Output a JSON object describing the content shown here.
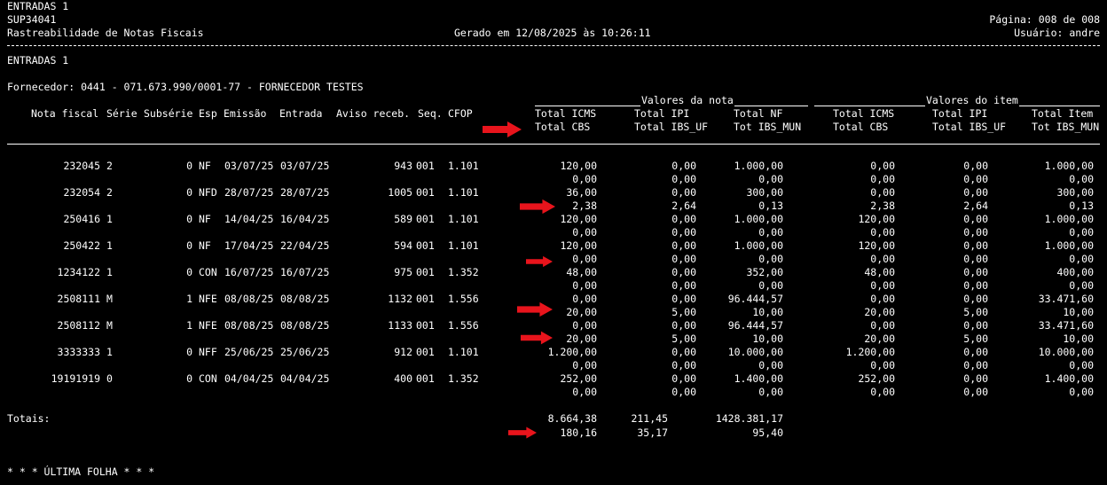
{
  "header": {
    "line1": "ENTRADAS 1",
    "program": "SUP34041",
    "title": "Rastreabilidade de Notas Fiscais",
    "generated": "Gerado em 12/08/2025 às 10:26:11",
    "page": "Página: 008 de 008",
    "user": "Usuário: andre"
  },
  "section_title": "ENTRADAS 1",
  "supplier": "Fornecedor: 0441 - 071.673.990/0001-77 - FORNECEDOR TESTES",
  "group_headers": {
    "nota": "Valores da nota",
    "item": "Valores do item"
  },
  "columns": {
    "nota_fiscal": "Nota fiscal",
    "serie": "Série",
    "subserie": "Subsérie",
    "esp": "Esp",
    "emissao": "Emissão",
    "entrada": "Entrada",
    "aviso": "Aviso receb.",
    "seq": "Seq.",
    "cfop": "CFOP",
    "n_total_icms": "Total ICMS",
    "n_total_cbs": "Total CBS",
    "n_total_ipi": "Total IPI",
    "n_total_ibs_uf": "Total IBS_UF",
    "n_total_nf": "Total NF",
    "n_tot_ibs_mun": "Tot IBS_MUN",
    "i_total_icms": "Total ICMS",
    "i_total_cbs": "Total CBS",
    "i_total_ipi": "Total IPI",
    "i_total_ibs_uf": "Total IBS_UF",
    "i_total_item": "Total Item",
    "i_tot_ibs_mun": "Tot IBS_MUN"
  },
  "rows": [
    {
      "nf": "232045",
      "serie": "2",
      "sub": "0",
      "esp": "NF",
      "emissao": "03/07/25",
      "entrada": "03/07/25",
      "aviso": "943",
      "seq": "001",
      "cfop": "1.101",
      "a": [
        "120,00",
        "0,00",
        "1.000,00",
        "0,00",
        "0,00",
        "1.000,00"
      ],
      "b": [
        "0,00",
        "0,00",
        "0,00",
        "0,00",
        "0,00",
        "0,00"
      ]
    },
    {
      "nf": "232054",
      "serie": "2",
      "sub": "0",
      "esp": "NFD",
      "emissao": "28/07/25",
      "entrada": "28/07/25",
      "aviso": "1005",
      "seq": "001",
      "cfop": "1.101",
      "a": [
        "36,00",
        "0,00",
        "300,00",
        "0,00",
        "0,00",
        "300,00"
      ],
      "b": [
        "2,38",
        "2,64",
        "0,13",
        "2,38",
        "2,64",
        "0,13"
      ]
    },
    {
      "nf": "250416",
      "serie": "1",
      "sub": "0",
      "esp": "NF",
      "emissao": "14/04/25",
      "entrada": "16/04/25",
      "aviso": "589",
      "seq": "001",
      "cfop": "1.101",
      "a": [
        "120,00",
        "0,00",
        "1.000,00",
        "120,00",
        "0,00",
        "1.000,00"
      ],
      "b": [
        "0,00",
        "0,00",
        "0,00",
        "0,00",
        "0,00",
        "0,00"
      ]
    },
    {
      "nf": "250422",
      "serie": "1",
      "sub": "0",
      "esp": "NF",
      "emissao": "17/04/25",
      "entrada": "22/04/25",
      "aviso": "594",
      "seq": "001",
      "cfop": "1.101",
      "a": [
        "120,00",
        "0,00",
        "1.000,00",
        "120,00",
        "0,00",
        "1.000,00"
      ],
      "b": [
        "0,00",
        "0,00",
        "0,00",
        "0,00",
        "0,00",
        "0,00"
      ]
    },
    {
      "nf": "1234122",
      "serie": "1",
      "sub": "0",
      "esp": "CON",
      "emissao": "16/07/25",
      "entrada": "16/07/25",
      "aviso": "975",
      "seq": "001",
      "cfop": "1.352",
      "a": [
        "48,00",
        "0,00",
        "352,00",
        "48,00",
        "0,00",
        "400,00"
      ],
      "b": [
        "0,00",
        "0,00",
        "0,00",
        "0,00",
        "0,00",
        "0,00"
      ]
    },
    {
      "nf": "2508111",
      "serie": "M",
      "sub": "1",
      "esp": "NFE",
      "emissao": "08/08/25",
      "entrada": "08/08/25",
      "aviso": "1132",
      "seq": "001",
      "cfop": "1.556",
      "a": [
        "0,00",
        "0,00",
        "96.444,57",
        "0,00",
        "0,00",
        "33.471,60"
      ],
      "b": [
        "20,00",
        "5,00",
        "10,00",
        "20,00",
        "5,00",
        "10,00"
      ]
    },
    {
      "nf": "2508112",
      "serie": "M",
      "sub": "1",
      "esp": "NFE",
      "emissao": "08/08/25",
      "entrada": "08/08/25",
      "aviso": "1133",
      "seq": "001",
      "cfop": "1.556",
      "a": [
        "0,00",
        "0,00",
        "96.444,57",
        "0,00",
        "0,00",
        "33.471,60"
      ],
      "b": [
        "20,00",
        "5,00",
        "10,00",
        "20,00",
        "5,00",
        "10,00"
      ]
    },
    {
      "nf": "3333333",
      "serie": "1",
      "sub": "0",
      "esp": "NFF",
      "emissao": "25/06/25",
      "entrada": "25/06/25",
      "aviso": "912",
      "seq": "001",
      "cfop": "1.101",
      "a": [
        "1.200,00",
        "0,00",
        "10.000,00",
        "1.200,00",
        "0,00",
        "10.000,00"
      ],
      "b": [
        "0,00",
        "0,00",
        "0,00",
        "0,00",
        "0,00",
        "0,00"
      ]
    },
    {
      "nf": "19191919",
      "serie": "0",
      "sub": "0",
      "esp": "CON",
      "emissao": "04/04/25",
      "entrada": "04/04/25",
      "aviso": "400",
      "seq": "001",
      "cfop": "1.352",
      "a": [
        "252,00",
        "0,00",
        "1.400,00",
        "252,00",
        "0,00",
        "1.400,00"
      ],
      "b": [
        "0,00",
        "0,00",
        "0,00",
        "0,00",
        "0,00",
        "0,00"
      ]
    }
  ],
  "totals": {
    "label": "Totais:",
    "a": [
      "8.664,38",
      "211,45",
      "1428.381,17"
    ],
    "b": [
      "180,16",
      "35,17",
      "95,40"
    ]
  },
  "footer": "* * * ÚLTIMA FOLHA * * *",
  "colors": {
    "background": "#000000",
    "text": "#ffffff",
    "arrow": "#e8141c"
  }
}
